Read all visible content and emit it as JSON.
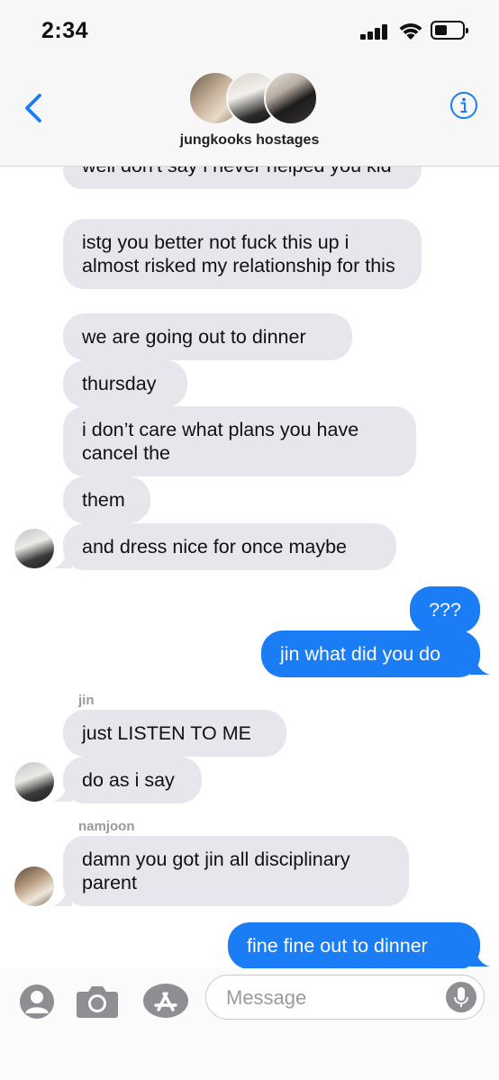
{
  "status_bar": {
    "time": "2:34"
  },
  "header": {
    "title": "jungkooks hostages"
  },
  "messages": [
    {
      "text": "well don't say i never helped you kid"
    },
    {
      "text": "istg you better not fuck this up i almost risked my relationship for this"
    },
    {
      "text": "we are going out to dinner"
    },
    {
      "text": "thursday"
    },
    {
      "text": "i don’t care what plans you have cancel the"
    },
    {
      "text": "them"
    },
    {
      "text": "and dress nice for once maybe"
    },
    {
      "text": "???"
    },
    {
      "text": "jin what did you do"
    },
    {
      "sender": "jin",
      "text": "just LISTEN TO ME"
    },
    {
      "text": "do as i say"
    },
    {
      "sender": "namjoon",
      "text": "damn you got jin all disciplinary parent"
    },
    {
      "text": "fine fine out to dinner"
    }
  ],
  "compose": {
    "placeholder": "Message"
  },
  "colors": {
    "outgoing": "#1b7df6",
    "incoming": "#e8e6ed",
    "accent": "#1b7df6"
  },
  "icons": [
    "back-chevron-icon",
    "info-icon",
    "memoji-icon",
    "camera-icon",
    "app-store-icon",
    "microphone-icon"
  ]
}
